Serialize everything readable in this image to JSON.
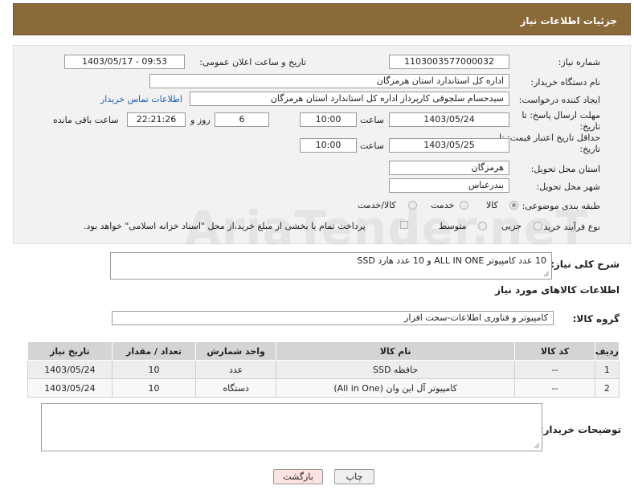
{
  "header": {
    "title": "جزئیات اطلاعات نیاز"
  },
  "form": {
    "need_number": {
      "label": "شماره نیاز:",
      "value": "1103003577000032"
    },
    "announce": {
      "label": "تاریخ و ساعت اعلان عمومی:",
      "value": "1403/05/17 - 09:53"
    },
    "buyer_org": {
      "label": "نام دستگاه خریدار:",
      "value": "اداره کل استاندارد استان هرمزگان"
    },
    "creator": {
      "label": "ایجاد کننده درخواست:",
      "value": "سیدحسام سلجوقی کارپرداز اداره کل استاندارد استان هرمزگان",
      "contact_link": "اطلاعات تماس خریدار"
    },
    "reply_deadline": {
      "label_line1": "مهلت ارسال پاسخ: تا",
      "label_line2": "تاریخ:",
      "date": "1403/05/24",
      "time_label": "ساعت",
      "time": "10:00",
      "days": "6",
      "days_label": "روز و",
      "remaining": "22:21:26",
      "remaining_label": "ساعت باقی مانده"
    },
    "price_validity": {
      "label_line1": "حداقل تاریخ اعتبار قیمت: تا",
      "label_line2": "تاریخ:",
      "date": "1403/05/25",
      "time_label": "ساعت",
      "time": "10:00"
    },
    "province": {
      "label": "استان محل تحویل:",
      "value": "هرمزگان"
    },
    "city": {
      "label": "شهر محل تحویل:",
      "value": "بندرعباس"
    },
    "category": {
      "label": "طبقه بندی موضوعی:",
      "options": [
        "کالا",
        "خدمت",
        "کالا/خدمت"
      ]
    },
    "purchase_type": {
      "label": "نوع فرآیند خرید :",
      "options": [
        "جزیی",
        "متوسط"
      ],
      "payment_note": "پرداخت تمام یا بخشی از مبلغ خرید،از محل \"اسناد خزانه اسلامی\" خواهد بود."
    }
  },
  "description": {
    "label": "شرح کلی نیاز:",
    "value": "10 عدد کامپیوتر  ALL IN ONE و 10 عدد هارد SSD"
  },
  "goods_info": {
    "title": "اطلاعات کالاهای مورد نیاز"
  },
  "goods_group": {
    "label": "گروه کالا:",
    "value": "کامپیوتر و فناوری اطلاعات-سخت افزار"
  },
  "table": {
    "headers": [
      "ردیف",
      "کد کالا",
      "نام کالا",
      "واحد شمارش",
      "تعداد / مقدار",
      "تاریخ نیاز"
    ],
    "rows": [
      [
        "1",
        "--",
        "حافظه SSD",
        "عدد",
        "10",
        "1403/05/24"
      ],
      [
        "2",
        "--",
        "کامپیوتر آل این وان (All in One)",
        "دستگاه",
        "10",
        "1403/05/24"
      ]
    ]
  },
  "buyer_notes": {
    "label": "توضیحات خریدار:"
  },
  "buttons": {
    "print": "چاپ",
    "back": "بازگشت"
  },
  "watermark": "AriaTender.neT"
}
